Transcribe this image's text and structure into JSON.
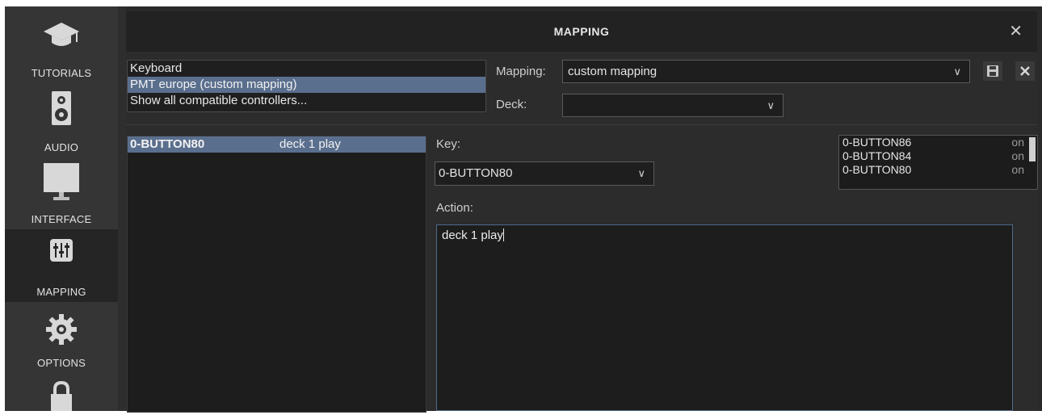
{
  "sidebar": {
    "items": [
      {
        "label": "TUTORIALS",
        "icon": "graduation-cap-icon"
      },
      {
        "label": "AUDIO",
        "icon": "speaker-icon"
      },
      {
        "label": "INTERFACE",
        "icon": "monitor-icon"
      },
      {
        "label": "MAPPING",
        "icon": "sliders-icon",
        "active": true
      },
      {
        "label": "OPTIONS",
        "icon": "gear-icon"
      },
      {
        "label": "",
        "icon": "lock-icon"
      }
    ]
  },
  "window": {
    "title": "MAPPING",
    "close_glyph": "✕"
  },
  "controllers": {
    "items": [
      "Keyboard",
      "PMT europe (custom mapping)",
      "Show all compatible controllers..."
    ],
    "selected_index": 1
  },
  "mapping_select": {
    "label": "Mapping:",
    "value": "custom mapping"
  },
  "deck_select": {
    "label": "Deck:",
    "value": ""
  },
  "mappings": [
    {
      "key": "0-BUTTON80",
      "action": "deck 1 play"
    }
  ],
  "key_field": {
    "label": "Key:",
    "value": "0-BUTTON80"
  },
  "key_list": [
    {
      "name": "0-BUTTON86",
      "state": "on"
    },
    {
      "name": "0-BUTTON84",
      "state": "on"
    },
    {
      "name": "0-BUTTON80",
      "state": "on"
    }
  ],
  "action_field": {
    "label": "Action:",
    "value": "deck 1 play"
  },
  "colors": {
    "selection": "#5a6f8e",
    "background": "#2a2a2a",
    "panel": "#1d1d1d"
  }
}
